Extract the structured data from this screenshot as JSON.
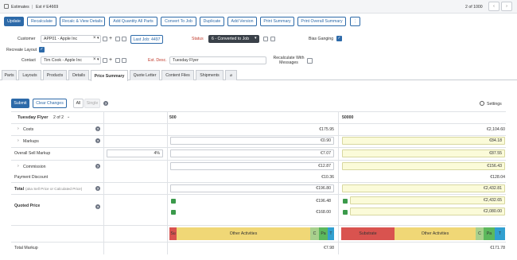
{
  "breadcrumb": {
    "root": "Estimates",
    "current": "Est # E4669"
  },
  "pager": {
    "text": "2 of 1000",
    "prev_icon": "chevron-left-icon",
    "next_icon": "chevron-right-icon"
  },
  "toolbar": {
    "update": "Update",
    "recalculate": "Recalculate",
    "recalc_view": "Recalc & View Details",
    "add_quantity": "Add Quantity All Parts",
    "convert_job": "Convert To Job",
    "duplicate": "Duplicate",
    "add_version": "Add Version",
    "print_summary": "Print Summary",
    "print_overall": "Print Overall Summary",
    "more": "⋮"
  },
  "header_form": {
    "customer_label": "Customer",
    "customer_value": "APP01 - Apple Inc",
    "last_job": "Last Job: 4497",
    "status_label": "Status",
    "status_value": "6 - Converted to Job",
    "bias_ganging_label": "Bias Ganging",
    "recreate_layout_label": "Recreate Layout",
    "contact_label": "Contact",
    "contact_value": "Tim Cook - Apple Inc",
    "est_desc_label": "Est. Desc.",
    "est_desc_value": "Tuesday Flyer",
    "recalc_messages_label": "Recalculate With Messages"
  },
  "tabs": [
    "Parts",
    "Layouts",
    "Products",
    "Details",
    "Price Summary",
    "Quote Letter",
    "Content Files",
    "Shipments"
  ],
  "active_tab": "Price Summary",
  "summary_toolbar": {
    "submit": "Submit",
    "clear": "Clear Changes",
    "all": "All",
    "single": "Single",
    "help": "?",
    "settings": "Settings"
  },
  "part": {
    "name": "Tuesday Flyer",
    "counter": "2 of 2"
  },
  "quantities": [
    "500",
    "50000"
  ],
  "rows": {
    "costs": {
      "label": "Costs",
      "q1": "€175.95",
      "q2": "€2,104.60"
    },
    "markups": {
      "label": "Markups",
      "q1": "€0.90",
      "q2": "€84.18"
    },
    "overall_markup": {
      "label": "Overall Sell Markup",
      "pct": "4%",
      "q1": "€7.07",
      "q2": "€87.55"
    },
    "commission": {
      "label": "Commission",
      "q1": "€12.87",
      "q2": "€156.43"
    },
    "payment_discount": {
      "label": "Payment Discount",
      "q1": "€10.36",
      "q2": "€128.04"
    },
    "total": {
      "label": "Total",
      "sub": "(aka Sell Price or Calculated Price)",
      "q1": "€196.80",
      "q2": "€2,432.81"
    },
    "quoted_price": {
      "label": "Quoted Price",
      "q1a": "€196.48",
      "q1b": "€168.00",
      "q2a": "€2,432.65",
      "q2b": "€2,080.00"
    },
    "total_markup": {
      "label": "Total Markup",
      "q1": "€7.98",
      "q2": "€171.78"
    }
  },
  "breakdown": {
    "q1": [
      {
        "label": "Su",
        "color": "#d9534f"
      },
      {
        "label": "Other Activities",
        "color": "#f0d776"
      },
      {
        "label": "C",
        "color": "#a8d08d"
      },
      {
        "label": "Pa",
        "color": "#5cb85c"
      },
      {
        "label": "T",
        "color": "#31a0d0"
      }
    ],
    "q2": [
      {
        "label": "Substrate",
        "color": "#d9534f"
      },
      {
        "label": "Other Activities",
        "color": "#f0d776"
      },
      {
        "label": "C",
        "color": "#a8d08d"
      },
      {
        "label": "Pa",
        "color": "#5cb85c"
      },
      {
        "label": "T",
        "color": "#31a0d0"
      }
    ]
  }
}
